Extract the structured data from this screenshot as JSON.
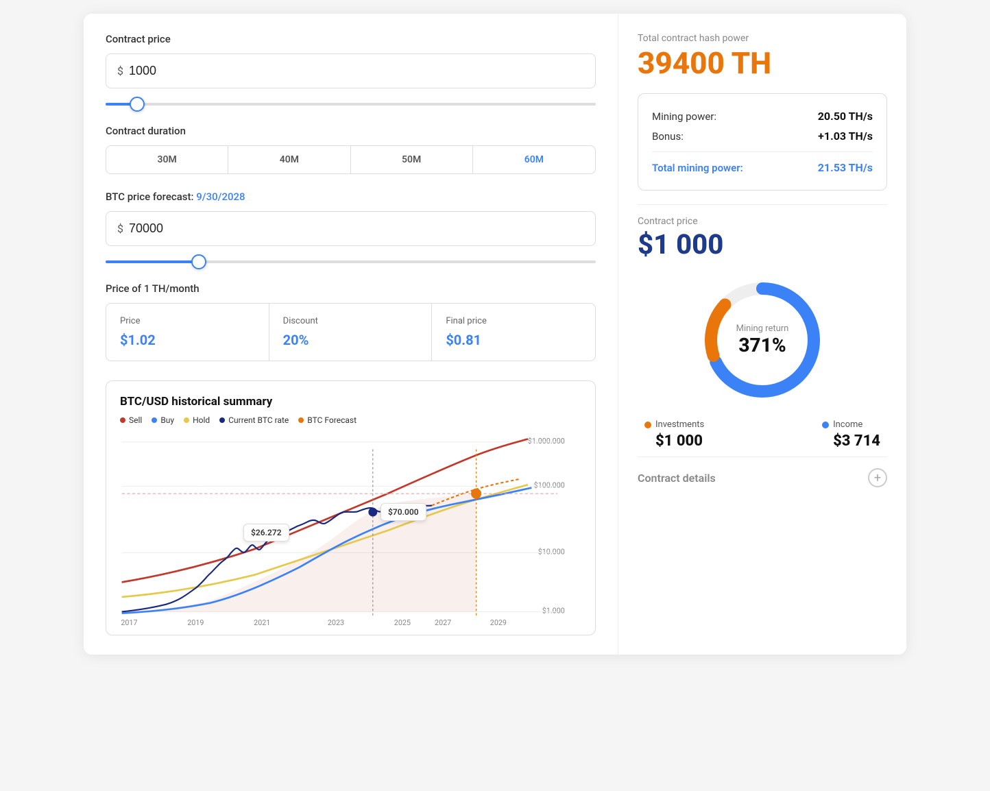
{
  "left": {
    "contract_price_label": "Contract price",
    "contract_price_value": "1000",
    "currency_symbol": "$",
    "duration_label": "Contract duration",
    "duration_tabs": [
      "30M",
      "40M",
      "50M",
      "60M"
    ],
    "active_duration_index": 3,
    "btc_forecast_label": "BTC price forecast:",
    "btc_forecast_date": "9/30/2028",
    "btc_price_value": "70000",
    "price_table": {
      "price_label": "Price",
      "price_value": "$1.02",
      "discount_label": "Discount",
      "discount_value": "20%",
      "final_price_label": "Final price",
      "final_price_value": "$0.81"
    },
    "chart": {
      "title": "BTC/USD historical summary",
      "legend": [
        {
          "label": "Sell",
          "color": "#c0392b"
        },
        {
          "label": "Buy",
          "color": "#3b82f6"
        },
        {
          "label": "Hold",
          "color": "#e6c84a"
        },
        {
          "label": "Current BTC rate",
          "color": "#1a2980"
        },
        {
          "label": "BTC Forecast",
          "color": "#e8760a"
        }
      ],
      "y_labels": [
        "$1.000.000",
        "$100.000",
        "$10.000",
        "$1.000"
      ],
      "x_labels": [
        "2017",
        "2019",
        "2021",
        "2023",
        "2025",
        "2027",
        "2029"
      ],
      "tooltip1_value": "$26.272",
      "tooltip2_value": "$70.000"
    }
  },
  "right": {
    "hash_power_label": "Total contract hash power",
    "hash_power_value": "39400 TH",
    "mining_power_label": "Mining power:",
    "mining_power_value": "20.50 TH/s",
    "bonus_label": "Bonus:",
    "bonus_value": "+1.03 TH/s",
    "total_mining_label": "Total mining power:",
    "total_mining_value": "21.53 TH/s",
    "contract_price_label": "Contract price",
    "contract_price_value": "$1 000",
    "donut": {
      "center_label": "Mining return",
      "center_value": "371%",
      "investments_label": "Investments",
      "investments_value": "$1 000",
      "income_label": "Income",
      "income_value": "$3 714",
      "invest_color": "#e8760a",
      "income_color": "#3b82f6"
    },
    "contract_details_label": "Contract details"
  }
}
